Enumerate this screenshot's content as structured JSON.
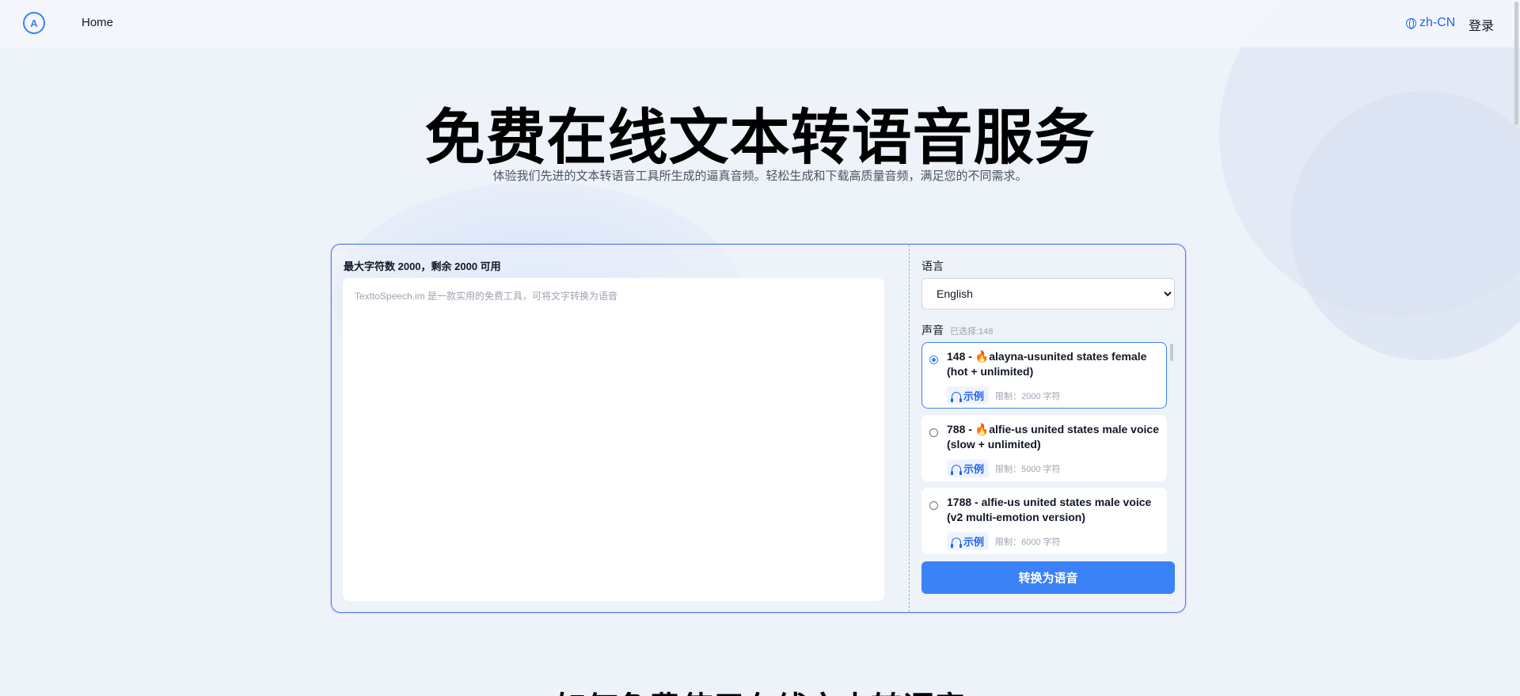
{
  "header": {
    "logo_text": "A",
    "home_label": "Home",
    "language_switch": "zh-CN",
    "login_label": "登录"
  },
  "hero": {
    "title": "免费在线文本转语音服务",
    "subtitle": "体验我们先进的文本转语音工具所生成的逼真音频。轻松生成和下载高质量音频，满足您的不同需求。"
  },
  "editor": {
    "char_info": "最大字符数 2000，剩余 2000 可用",
    "placeholder": "TexttoSpeech.im 是一款实用的免费工具，可将文字转换为语音",
    "value": ""
  },
  "settings": {
    "language_label": "语言",
    "language_value": "English",
    "voice_label": "声音",
    "voice_selected": "已选择:148",
    "voices": [
      {
        "name": "148 - 🔥alayna-usunited states female (hot + unlimited)",
        "sample": "示例",
        "limit": "限制：2000 字符",
        "selected": true
      },
      {
        "name": "788 - 🔥alfie-us united states male voice (slow + unlimited)",
        "sample": "示例",
        "limit": "限制：5000 字符",
        "selected": false
      },
      {
        "name": "1788 - alfie-us united states male voice (v2 multi-emotion version)",
        "sample": "示例",
        "limit": "限制：6000 字符",
        "selected": false
      }
    ],
    "convert_label": "转换为语音"
  },
  "section": {
    "title": "如何免费使用在线文本转语音"
  },
  "colors": {
    "accent": "#3b82f6",
    "accent_dark": "#2563eb",
    "background": "#eef2f9"
  }
}
